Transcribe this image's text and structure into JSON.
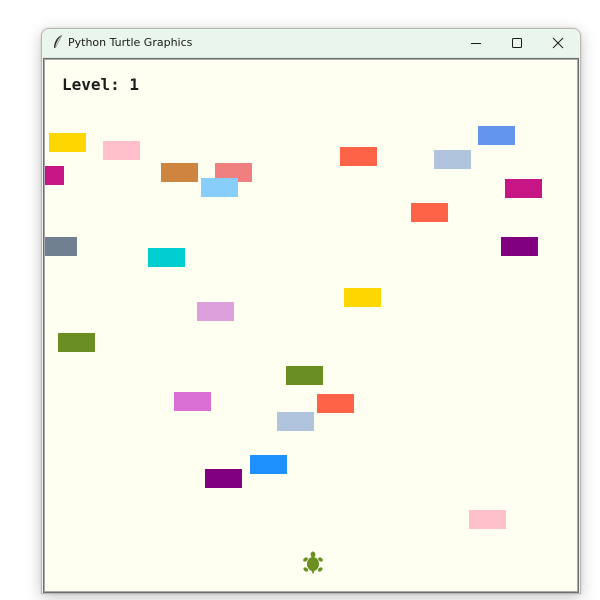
{
  "window": {
    "title": "Python Turtle Graphics",
    "icon": "feather-icon",
    "controls": [
      "minimize-icon",
      "maximize-icon",
      "close-icon"
    ]
  },
  "hud": {
    "level_text": "Level: 1"
  },
  "player": {
    "shape": "turtle",
    "color": "#6b8e23"
  },
  "canvas": {
    "background": "#fefff1"
  },
  "cars": [
    {
      "color": "#ffd700"
    },
    {
      "color": "#ffc0cb"
    },
    {
      "color": "#c71585"
    },
    {
      "color": "#cd853f"
    },
    {
      "color": "#f08080"
    },
    {
      "color": "#87cefa"
    },
    {
      "color": "#ff6347"
    },
    {
      "color": "#b0c4de"
    },
    {
      "color": "#6495ed"
    },
    {
      "color": "#c71585"
    },
    {
      "color": "#ff6347"
    },
    {
      "color": "#708090"
    },
    {
      "color": "#00ced1"
    },
    {
      "color": "#800080"
    },
    {
      "color": "#ffd700"
    },
    {
      "color": "#dda0dd"
    },
    {
      "color": "#6b8e23"
    },
    {
      "color": "#6b8e23"
    },
    {
      "color": "#da70d6"
    },
    {
      "color": "#ff6347"
    },
    {
      "color": "#b0c4de"
    },
    {
      "color": "#1e90ff"
    },
    {
      "color": "#800080"
    },
    {
      "color": "#ffc0cb"
    }
  ]
}
